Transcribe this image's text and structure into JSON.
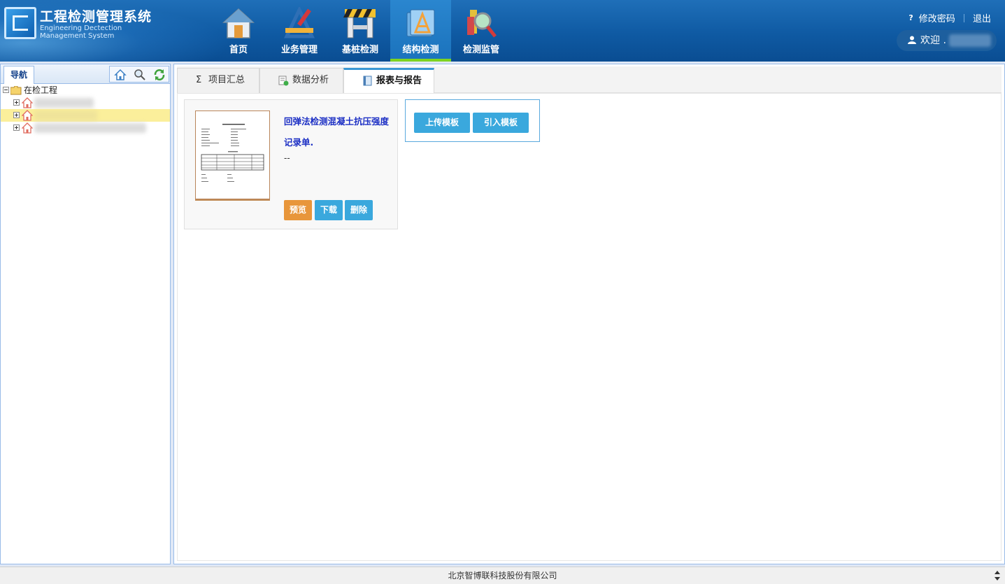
{
  "header": {
    "title": "工程检测管理系统",
    "subtitle": "Engineering Dectection Management System",
    "nav": [
      {
        "label": "首页",
        "icon": "home-icon"
      },
      {
        "label": "业务管理",
        "icon": "business-tools-icon"
      },
      {
        "label": "基桩检测",
        "icon": "pile-barrier-icon"
      },
      {
        "label": "结构检测",
        "icon": "structure-folder-icon",
        "active": true
      },
      {
        "label": "检测监管",
        "icon": "inspect-magnifier-icon"
      }
    ],
    "change_password": "修改密码",
    "logout": "退出",
    "welcome": "欢迎 ."
  },
  "sidebar": {
    "tab_label": "导航",
    "root_label": "在检工程"
  },
  "tabs": [
    {
      "label": "项目汇总",
      "icon": "sigma-icon"
    },
    {
      "label": "数据分析",
      "icon": "data-analysis-icon"
    },
    {
      "label": "报表与报告",
      "icon": "report-book-icon",
      "active": true
    }
  ],
  "template_card": {
    "title": "回弹法检测混凝土抗压强度记录单.",
    "description": "--",
    "preview_label": "预览",
    "download_label": "下载",
    "delete_label": "删除"
  },
  "template_actions": {
    "upload_label": "上传模板",
    "import_label": "引入模板"
  },
  "footer": {
    "company": "北京智博联科技股份有限公司"
  },
  "colors": {
    "header_bg": "#0f5aa3",
    "active_nav_underline": "#7ed321",
    "primary_button": "#3aa8dd",
    "preview_button": "#e8963b",
    "title_link": "#1c2fc4"
  }
}
